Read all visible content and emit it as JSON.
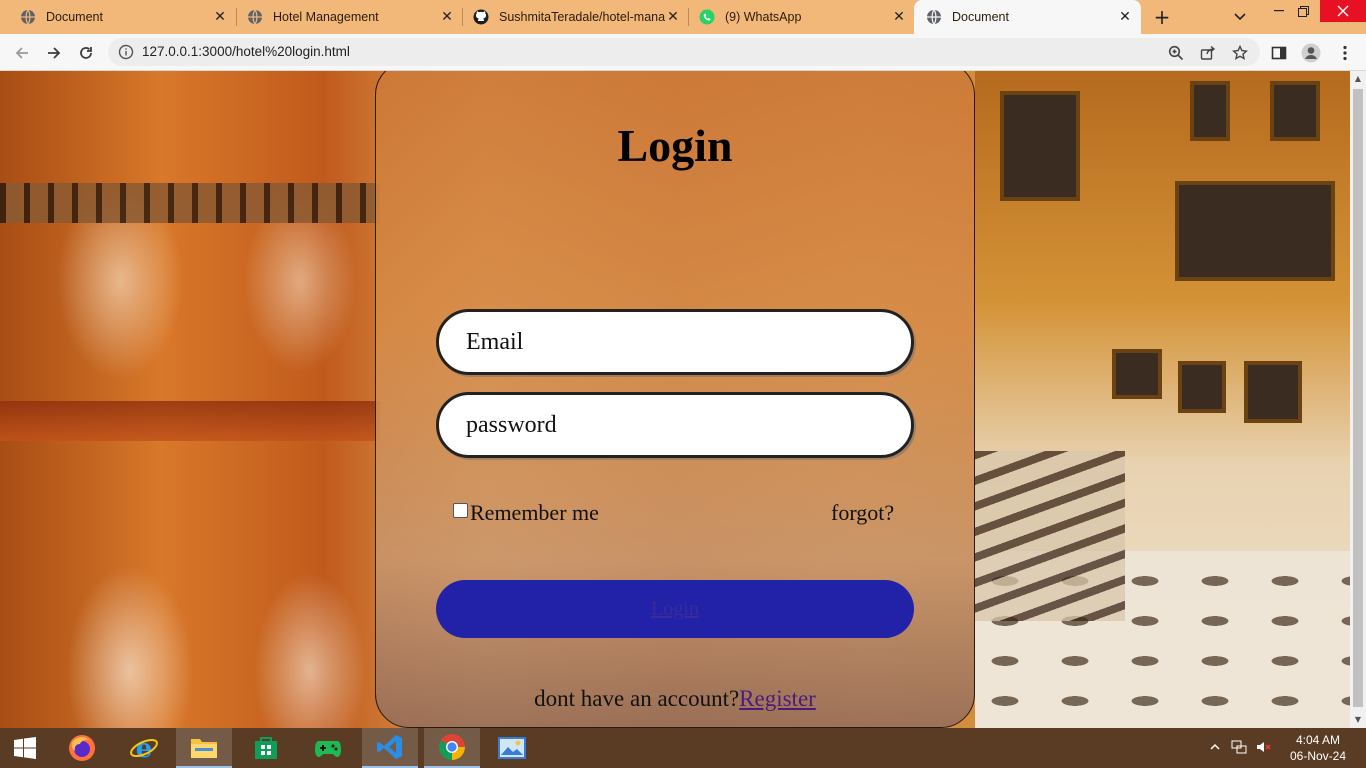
{
  "browser": {
    "tabs": [
      {
        "label": "Document",
        "icon": "globe-icon",
        "active": false
      },
      {
        "label": "Hotel Management",
        "icon": "globe-icon",
        "active": false
      },
      {
        "label": "SushmitaTeradale/hotel-mana",
        "icon": "github-icon",
        "active": false
      },
      {
        "label": "(9) WhatsApp",
        "icon": "whatsapp-icon",
        "active": false
      },
      {
        "label": "Document",
        "icon": "globe-icon",
        "active": true
      }
    ],
    "close_glyph": "✕",
    "new_tab_glyph": "+",
    "address": "127.0.0.1:3000/hotel%20login.html"
  },
  "login": {
    "title": "Login",
    "email_placeholder": "Email",
    "password_placeholder": "password",
    "remember_label": "Remember me",
    "forgot_label": "forgot?",
    "login_button": "Login",
    "account_prompt": "dont have an account?",
    "register_link": "Register"
  },
  "colors": {
    "login_button": "#2222a8",
    "tabstrip": "#f2b87a",
    "taskbar": "#5a3c24"
  },
  "taskbar": {
    "time": "4:04 AM",
    "date": "06-Nov-24"
  }
}
